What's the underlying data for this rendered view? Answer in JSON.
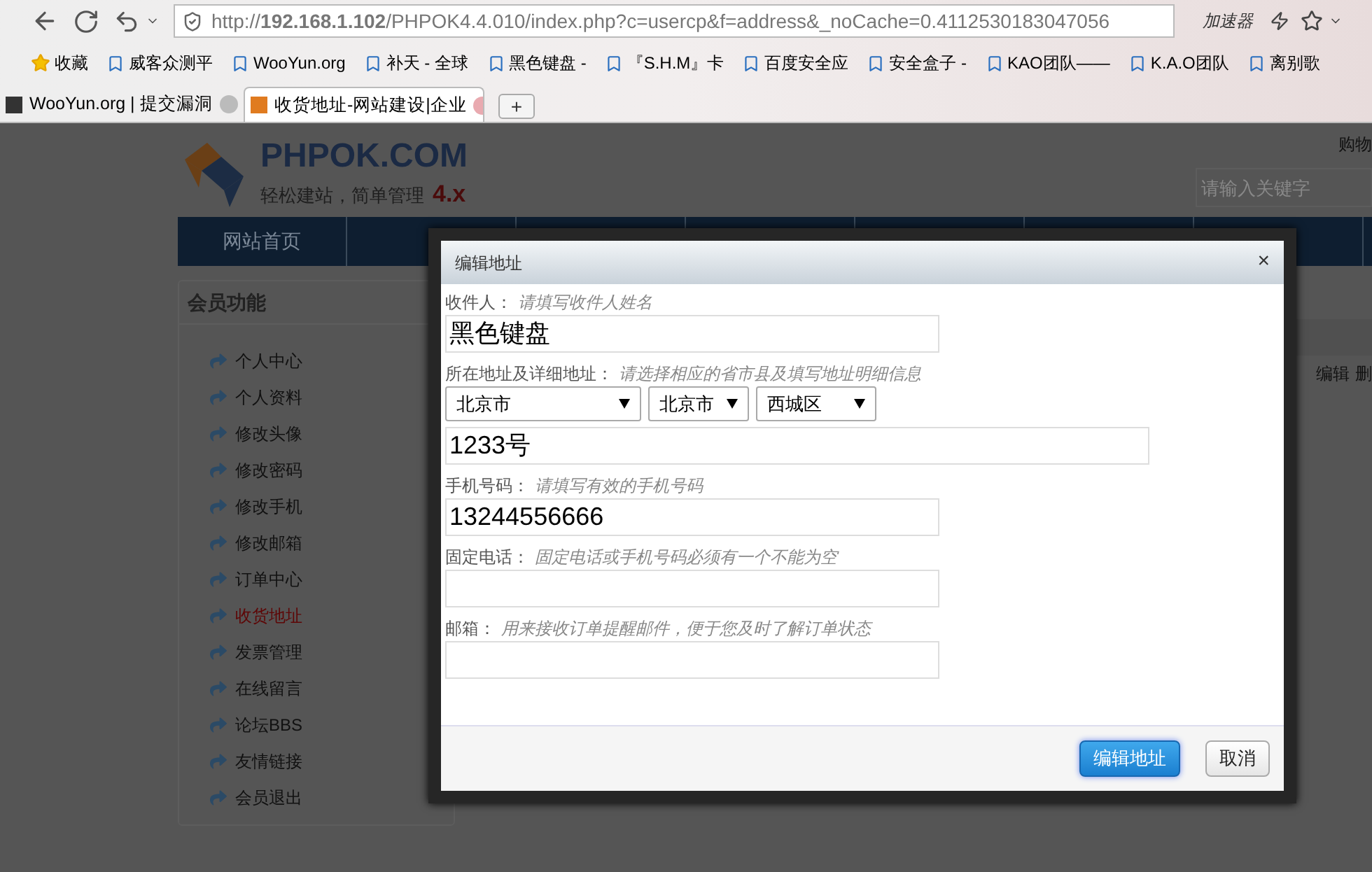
{
  "browser": {
    "url": "http://**192.168.1.102**/PHPOK4.4.010/index.php?c=usercp&f=address&_noCache=0.4112530183047056",
    "accelerator": "加速器",
    "bookmarks": [
      "收藏",
      "威客众测平",
      "WooYun.org",
      "补天 - 全球",
      "黑色键盘 -",
      "『S.H.M』卡",
      "百度安全应",
      "安全盒子 -",
      "KAO团队——",
      "K.A.O团队",
      "离别歌"
    ],
    "tabs": [
      {
        "label": "WooYun.org | 提交漏洞",
        "selected": false
      },
      {
        "label": "收货地址-网站建设|企业",
        "selected": true
      }
    ],
    "new_tab": "+"
  },
  "site": {
    "logo_name": "PHPOK.COM",
    "logo_slogan": "轻松建站，简单管理",
    "logo_version": "4.x",
    "cart_link": "购物",
    "search": {
      "placeholder": "请输入关键字"
    },
    "nav": [
      {
        "label": "网站首页"
      }
    ],
    "sidebar": {
      "title": "会员功能",
      "items": [
        {
          "label": "个人中心",
          "selected": false
        },
        {
          "label": "个人资料",
          "selected": false
        },
        {
          "label": "修改头像",
          "selected": false
        },
        {
          "label": "修改密码",
          "selected": false
        },
        {
          "label": "修改手机",
          "selected": false
        },
        {
          "label": "修改邮箱",
          "selected": false
        },
        {
          "label": "订单中心",
          "selected": false
        },
        {
          "label": "收货地址",
          "selected": true
        },
        {
          "label": "发票管理",
          "selected": false
        },
        {
          "label": "在线留言",
          "selected": false
        },
        {
          "label": "论坛BBS",
          "selected": false
        },
        {
          "label": "友情链接",
          "selected": false
        },
        {
          "label": "会员退出",
          "selected": false
        }
      ]
    },
    "row_actions": [
      "编辑",
      "删"
    ]
  },
  "dialog": {
    "title": "编辑地址",
    "close": "×",
    "fields": [
      {
        "kind": "text",
        "label": "收件人：",
        "hint": "请填写收件人姓名",
        "value": "黑色键盘"
      },
      {
        "kind": "address",
        "label": "所在地址及详细地址：",
        "hint": "请选择相应的省市县及填写地址明细信息",
        "selects": [
          "北京市",
          "北京市",
          "西城区"
        ]
      },
      {
        "kind": "detail",
        "value": "1233号"
      },
      {
        "kind": "text",
        "label": "手机号码：",
        "hint": "请填写有效的手机号码",
        "value": "13244556666"
      },
      {
        "kind": "text",
        "label": "固定电话：",
        "hint": "固定电话或手机号码必须有一个不能为空"
      },
      {
        "kind": "text",
        "label": "邮箱：",
        "hint": "用来接收订单提醒邮件，便于您及时了解订单状态"
      }
    ],
    "buttons": [
      {
        "label": "编辑地址",
        "kind": "primary"
      },
      {
        "label": "取消",
        "kind": "default"
      }
    ]
  }
}
